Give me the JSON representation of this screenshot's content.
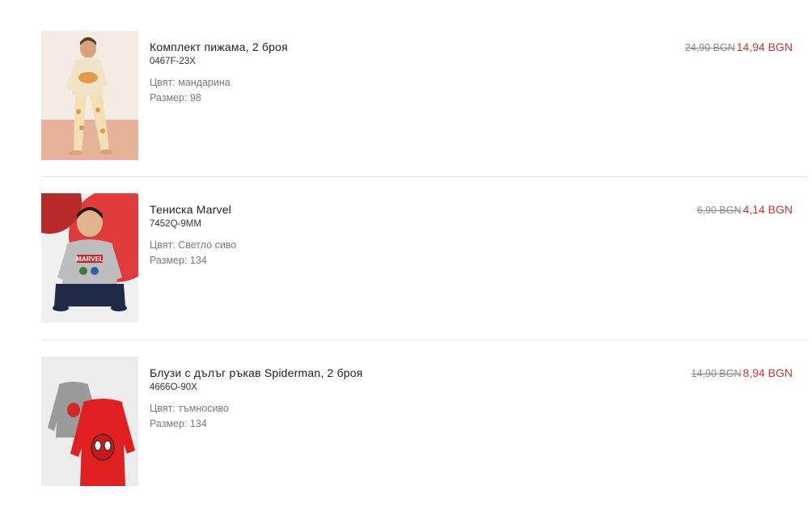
{
  "cart": {
    "items": [
      {
        "name": "Комплект пижама, 2 броя",
        "sku": "0467F-23X",
        "color_label": "Цвят:",
        "color_value": "мандарина",
        "size_label": "Размер:",
        "size_value": "98",
        "old_price": "24,90 BGN",
        "new_price": "14,94 BGN",
        "image_icon": "kid-pajama-photo"
      },
      {
        "name": "Тениска Marvel",
        "sku": "7452Q-9MM",
        "color_label": "Цвят:",
        "color_value": "Светло сиво",
        "size_label": "Размер:",
        "size_value": "134",
        "old_price": "6,90 BGN",
        "new_price": "4,14 BGN",
        "image_icon": "kid-marvel-shirt-photo"
      },
      {
        "name": "Блузи с дълъг ръкав Spiderman, 2 броя",
        "sku": "4666O-90X",
        "color_label": "Цвят:",
        "color_value": "тъмносиво",
        "size_label": "Размер:",
        "size_value": "134",
        "old_price": "14,90 BGN",
        "new_price": "8,94 BGN",
        "image_icon": "spiderman-shirts-photo"
      }
    ]
  },
  "colors": {
    "sale_price": "#d0342c",
    "old_price": "#8a8a8a",
    "divider": "#e6e6e6"
  }
}
